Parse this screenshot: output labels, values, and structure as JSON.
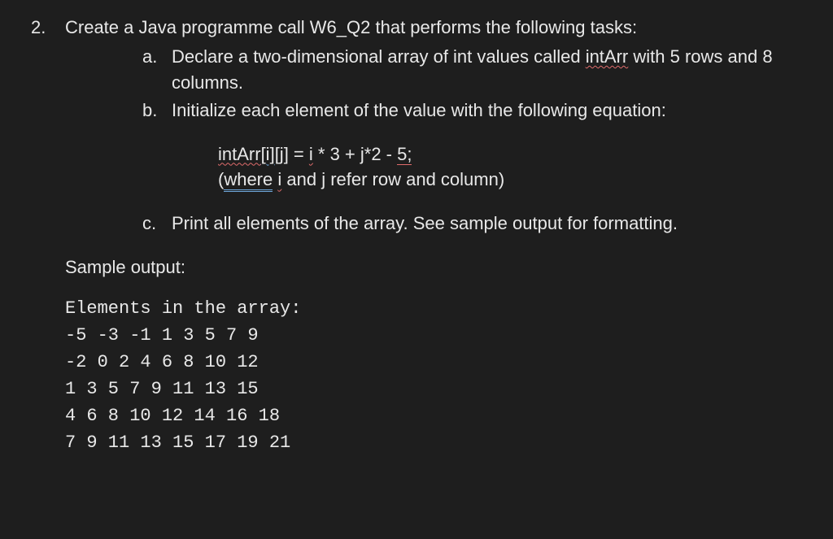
{
  "question": {
    "number": "2.",
    "intro_prefix": "Create a Java programme call ",
    "class_name": "W6_Q2",
    "intro_suffix": " that performs the following tasks:",
    "parts": {
      "a": {
        "letter": "a.",
        "text_prefix": "Declare a two-dimensional array of int values called ",
        "var_name": "intArr",
        "text_suffix": " with 5 rows and 8 columns."
      },
      "b": {
        "letter": "b.",
        "text": "Initialize each element of the value with the following equation:"
      },
      "c": {
        "letter": "c.",
        "text": "Print all elements of the array.  See sample output for formatting."
      }
    },
    "equation": {
      "lhs_arr": "intArr",
      "lhs_i": "[i]",
      "lhs_j": "[j]",
      "eq": " = ",
      "rhs_i": "i",
      "rhs_mid": " * 3 + j*2 - ",
      "rhs_end": "5;",
      "where_open": "(",
      "where_word": "where",
      "where_space": " ",
      "where_i": "i",
      "where_rest": " and j refer row and column)"
    },
    "sample_label": "Sample output:",
    "sample_output": "Elements in the array:\n-5 -3 -1 1 3 5 7 9\n-2 0 2 4 6 8 10 12\n1 3 5 7 9 11 13 15\n4 6 8 10 12 14 16 18\n7 9 11 13 15 17 19 21"
  }
}
